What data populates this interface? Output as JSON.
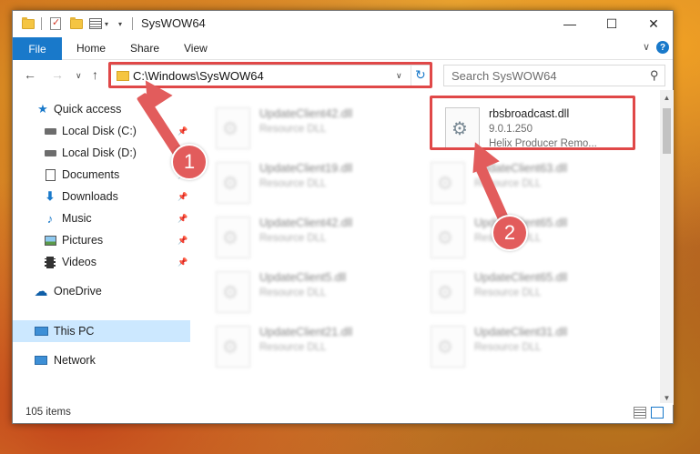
{
  "window": {
    "title": "SysWOW64",
    "controls": {
      "minimize": "—",
      "maximize": "☐",
      "close": "✕"
    }
  },
  "ribbon": {
    "tabs": [
      "File",
      "Home",
      "Share",
      "View"
    ],
    "expand_glyph": "∨",
    "help_glyph": "?"
  },
  "address_bar": {
    "back_glyph": "←",
    "forward_glyph": "→",
    "recent_glyph": "∨",
    "up_glyph": "↑",
    "path": "C:\\Windows\\SysWOW64",
    "dropdown_glyph": "∨",
    "refresh_glyph": "↻"
  },
  "search": {
    "placeholder": "Search SysWOW64",
    "icon": "search-icon"
  },
  "nav_pane": {
    "items": [
      {
        "label": "Quick access",
        "icon": "star-icon",
        "pinned": false
      },
      {
        "label": "Local Disk (C:)",
        "icon": "drive-icon",
        "pinned": true
      },
      {
        "label": "Local Disk (D:)",
        "icon": "drive-icon",
        "pinned": false
      },
      {
        "label": "Documents",
        "icon": "documents-icon",
        "pinned": true
      },
      {
        "label": "Downloads",
        "icon": "downloads-icon",
        "pinned": true
      },
      {
        "label": "Music",
        "icon": "music-icon",
        "pinned": true
      },
      {
        "label": "Pictures",
        "icon": "pictures-icon",
        "pinned": true
      },
      {
        "label": "Videos",
        "icon": "videos-icon",
        "pinned": true
      },
      {
        "label": "OneDrive",
        "icon": "onedrive-icon",
        "pinned": false
      },
      {
        "label": "This PC",
        "icon": "computer-icon",
        "pinned": false,
        "selected": true
      },
      {
        "label": "Network",
        "icon": "network-icon",
        "pinned": false
      }
    ],
    "pin_glyph": "📌"
  },
  "files": {
    "highlighted": {
      "name": "rbsbroadcast.dll",
      "version": "9.0.1.250",
      "description": "Helix Producer Remo..."
    },
    "background": [
      {
        "name": "UpdateClient42.dll",
        "type": "Resource DLL"
      },
      {
        "name": "UpdateClient19.dll",
        "type": "Resource DLL"
      },
      {
        "name": "UpdateClient63.dll",
        "type": "Resource DLL"
      },
      {
        "name": "UpdateClient42.dll",
        "type": "Resource DLL"
      },
      {
        "name": "UpdateClient65.dll",
        "type": "Resource DLL"
      },
      {
        "name": "UpdateClient5.dll",
        "type": "Resource DLL"
      },
      {
        "name": "UpdateClient65.dll",
        "type": "Resource DLL"
      },
      {
        "name": "UpdateClient21.dll",
        "type": "Resource DLL"
      },
      {
        "name": "UpdateClient31.dll",
        "type": "Resource DLL"
      }
    ]
  },
  "status": {
    "item_count": "105 items"
  },
  "annotations": {
    "step1": "1",
    "step2": "2",
    "color": "#e25c5c"
  },
  "colors": {
    "accent": "#1979ca",
    "selection": "#cce8ff",
    "highlight_border": "#e04848"
  }
}
